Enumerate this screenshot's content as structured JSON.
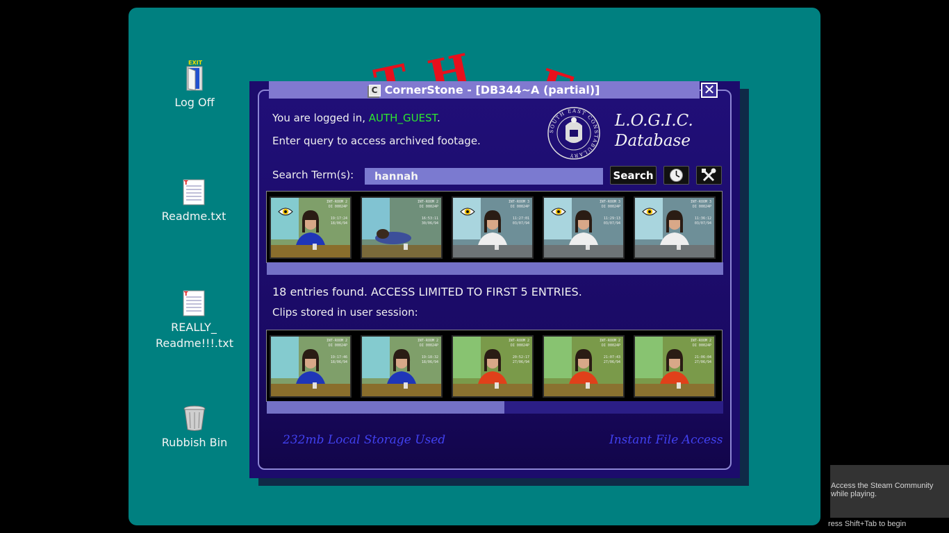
{
  "desktop": {
    "background_color": "#008080",
    "background_title": "THE",
    "icons": [
      {
        "label": "Log Off",
        "icon": "exit-door-icon",
        "badge": "EXIT"
      },
      {
        "label": "Readme.txt",
        "icon": "text-file-icon"
      },
      {
        "label": "REALLY_\nReadme!!!.txt",
        "icon": "text-file-icon"
      },
      {
        "label": "Rubbish Bin",
        "icon": "trash-bin-icon"
      }
    ]
  },
  "window": {
    "title": "CornerStone - [DB344~A (partial)]",
    "app_icon_letter": "C",
    "close_label": "✕",
    "login_prefix": "You are logged in, ",
    "login_user": "AUTH_GUEST",
    "login_suffix": ".",
    "instruction": "Enter query to access archived footage.",
    "logo_line1": "L.O.G.I.C.",
    "logo_line2": "Database",
    "emblem_ring_text": "SOUTH EAST CONSTABULARY",
    "search_label": "Search Term(s):",
    "search_value": "hannah",
    "search_button": "Search",
    "history_icon": "clock-icon",
    "settings_icon": "tools-icon",
    "results_message": "18 entries found. ACCESS LIMITED TO FIRST 5 ENTRIES.",
    "session_label": "Clips stored in user session:",
    "storage_text": "232mb Local Storage Used",
    "access_text": "Instant File Access",
    "session_storage_fraction": 0.52,
    "colors": {
      "accent": "#8179d0",
      "user": "#2ee82e",
      "status": "#4141f0"
    }
  },
  "search_results": [
    {
      "room": "INT-ROOM 2",
      "code": "DI 00024P",
      "time": "19:17:24",
      "date": "18/06/94",
      "watched": true,
      "outfit": "blue"
    },
    {
      "room": "INT-ROOM 2",
      "code": "DI 00024P",
      "time": "16:53:11",
      "date": "30/06/94",
      "watched": false,
      "outfit": "slumped"
    },
    {
      "room": "INT-ROOM 3",
      "code": "DI 00024P",
      "time": "11:27:01",
      "date": "03/07/94",
      "watched": true,
      "outfit": "white"
    },
    {
      "room": "INT-ROOM 3",
      "code": "DI 00024P",
      "time": "11:29:13",
      "date": "03/07/94",
      "watched": true,
      "outfit": "white"
    },
    {
      "room": "INT-ROOM 3",
      "code": "DI 00024P",
      "time": "11:36:12",
      "date": "03/07/94",
      "watched": true,
      "outfit": "white"
    }
  ],
  "session_clips": [
    {
      "room": "INT-ROOM 2",
      "code": "DI 00024P",
      "time": "19:17:46",
      "date": "18/06/94",
      "outfit": "blue"
    },
    {
      "room": "INT-ROOM 2",
      "code": "DI 00024P",
      "time": "19:18:32",
      "date": "18/06/94",
      "outfit": "blue"
    },
    {
      "room": "INT-ROOM 2",
      "code": "DI 00024P",
      "time": "20:52:17",
      "date": "27/06/94",
      "outfit": "red"
    },
    {
      "room": "INT-ROOM 2",
      "code": "DI 00024P",
      "time": "21:07:43",
      "date": "27/06/94",
      "outfit": "red"
    },
    {
      "room": "INT-ROOM 2",
      "code": "DI 00024P",
      "time": "21:06:04",
      "date": "27/06/94",
      "outfit": "red"
    }
  ],
  "steam": {
    "popup_text": "Access the Steam Community while playing.",
    "hint_text": "ress Shift+Tab to begin"
  }
}
